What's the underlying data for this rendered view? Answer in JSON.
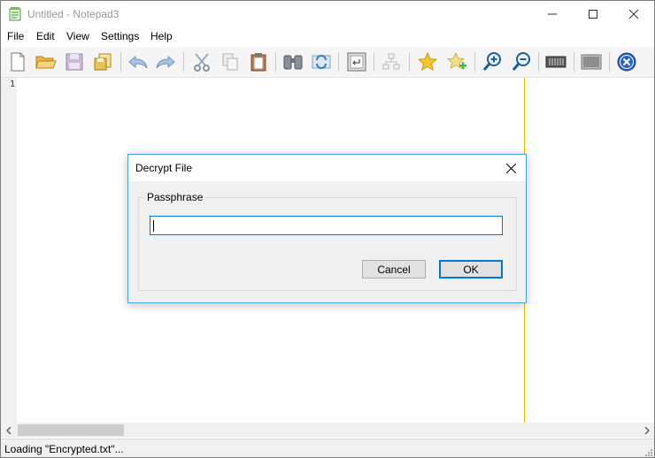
{
  "window": {
    "title": "Untitled - Notepad3"
  },
  "menu": [
    "File",
    "Edit",
    "View",
    "Settings",
    "Help"
  ],
  "toolbar": {
    "buttons": [
      "new-file",
      "open-file",
      "save-file",
      "save-as",
      "undo",
      "redo",
      "cut",
      "copy",
      "paste",
      "find",
      "replace",
      "word-wrap",
      "schema",
      "favorite",
      "add-favorite",
      "zoom-in",
      "zoom-out",
      "column-mode",
      "terminal",
      "exit"
    ]
  },
  "editor": {
    "line_number": "1"
  },
  "dialog": {
    "title": "Decrypt File",
    "group_label": "Passphrase",
    "input_value": "",
    "cancel_label": "Cancel",
    "ok_label": "OK"
  },
  "status": {
    "text": "Loading \"Encrypted.txt\"..."
  },
  "colors": {
    "accent": "#0078d7",
    "long_line_marker": "#e6c000",
    "dialog_border": "#4aa3df"
  }
}
